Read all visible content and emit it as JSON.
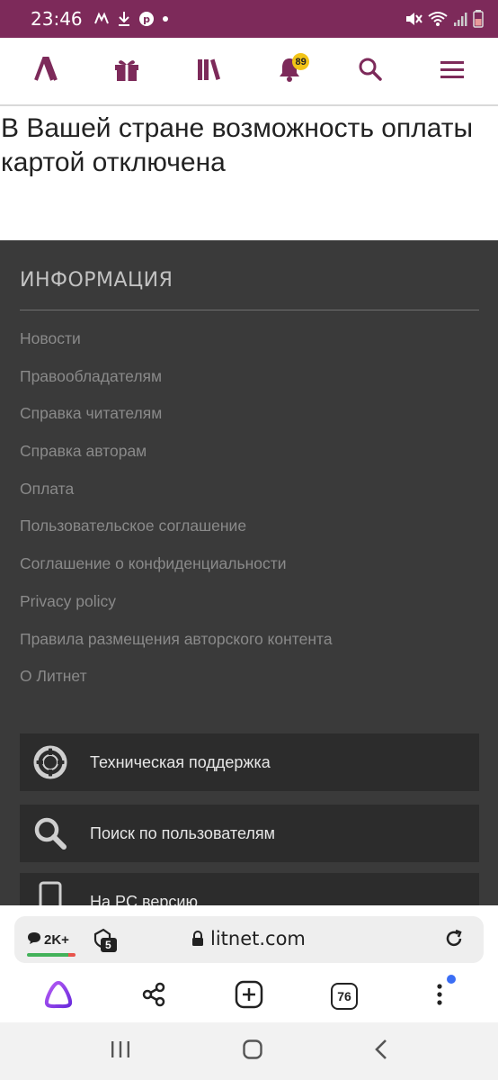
{
  "status_bar": {
    "time": "23:46",
    "left_icons": [
      "missed-call-icon",
      "download-icon",
      "pinterest-icon",
      "dot-icon"
    ],
    "right_icons": [
      "mute-icon",
      "wifi-icon",
      "signal-icon",
      "battery-icon"
    ]
  },
  "top_nav": {
    "items": [
      "logo-icon",
      "gift-icon",
      "library-icon",
      "bell-icon",
      "search-icon",
      "menu-icon"
    ],
    "notification_count": "89",
    "accent_color": "#7d2a5a"
  },
  "message": "В Вашей стране возможность оплаты картой отключена",
  "footer": {
    "title": "ИНФОРМАЦИЯ",
    "links": [
      "Новости",
      "Правообладателям",
      "Справка читателям",
      "Справка авторам",
      "Оплата",
      "Пользовательское соглашение",
      "Соглашение о конфиденциальности",
      "Privacy policy",
      "Правила размещения авторского контента",
      "О Литнет"
    ],
    "actions": [
      {
        "label": "Техническая поддержка",
        "icon": "lifebuoy-icon"
      },
      {
        "label": "Поиск по пользователям",
        "icon": "search-icon"
      },
      {
        "label": "На PC версию",
        "icon": "phone-icon"
      }
    ]
  },
  "browser": {
    "comments_count": "2K+",
    "shield_count": "5",
    "url": "litnet.com",
    "tab_count": "76",
    "toolbar_icons": [
      "alice-icon",
      "share-icon",
      "new-tab-icon",
      "tabs-icon",
      "more-icon"
    ]
  },
  "system_nav": [
    "recents-icon",
    "home-icon",
    "back-icon"
  ]
}
